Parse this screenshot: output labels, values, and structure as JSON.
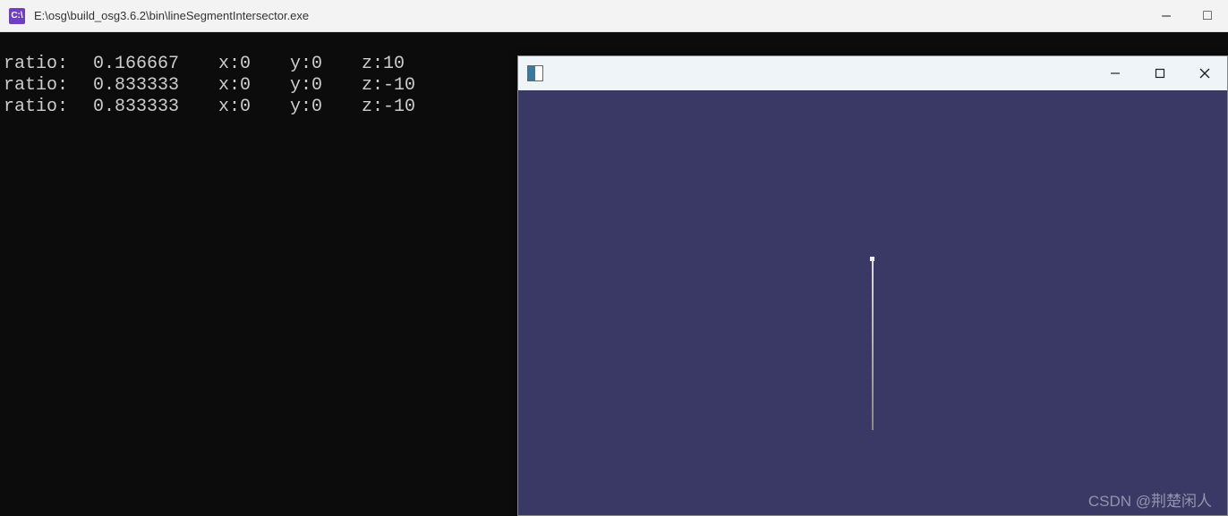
{
  "console": {
    "icon_label": "C:\\",
    "title": "E:\\osg\\build_osg3.6.2\\bin\\lineSegmentIntersector.exe",
    "lines": [
      {
        "ratio_label": "ratio:",
        "ratio": "0.166667",
        "x": "x:0",
        "y": "y:0",
        "z": "z:10"
      },
      {
        "ratio_label": "ratio:",
        "ratio": "0.833333",
        "x": "x:0",
        "y": "y:0",
        "z": "z:-10"
      },
      {
        "ratio_label": "ratio:",
        "ratio": "0.833333",
        "x": "x:0",
        "y": "y:0",
        "z": "z:-10"
      }
    ]
  },
  "viewer": {
    "controls": {
      "minimize": "—",
      "maximize": "□",
      "close": "✕"
    }
  },
  "console_controls": {
    "minimize": "—",
    "maximize": "□"
  },
  "watermark": "CSDN @荆楚闲人"
}
